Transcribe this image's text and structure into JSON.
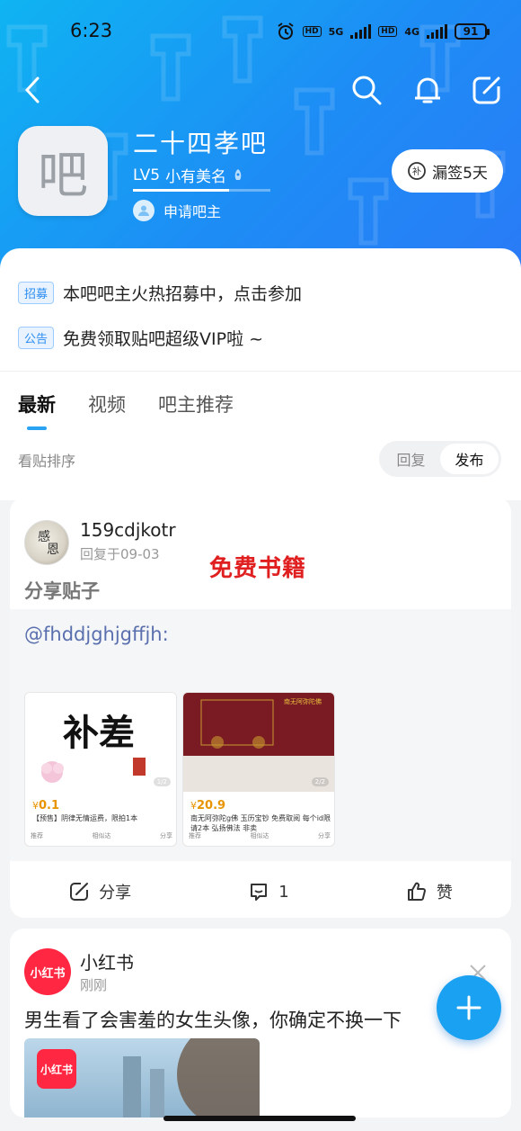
{
  "status_bar": {
    "time": "6:23",
    "net1": "5G",
    "net2": "4G",
    "battery": "91"
  },
  "forum": {
    "avatar_char": "吧",
    "name": "二十四孝吧",
    "level": "LV5",
    "level_title": "小有美名",
    "level_progress": 0.7,
    "apply_owner": "申请吧主",
    "sign_label": "漏签5天"
  },
  "notices": [
    {
      "tag": "招募",
      "text": "本吧吧主火热招募中，点击参加"
    },
    {
      "tag": "公告",
      "text": "免费领取贴吧超级VIP啦 ~"
    }
  ],
  "tabs": [
    "最新",
    "视频",
    "吧主推荐"
  ],
  "sort": {
    "label": "看贴排序",
    "options": [
      "回复",
      "发布"
    ],
    "selected": "发布"
  },
  "post": {
    "username": "159cdjkotr",
    "time": "回复于09-03",
    "overlay_text": "免费书籍",
    "title": "分享贴子",
    "mention": "@fhddjghjgffjh:",
    "goods": [
      {
        "image_text": "补差",
        "price": "0.1",
        "desc": "【预售】阴律无情运费，限拍1本",
        "pager": "1/2",
        "foot": [
          "推荐",
          "相似达",
          "分享"
        ]
      },
      {
        "image_text": "南无阿弥陀佛",
        "price": "20.9",
        "desc": "南无阿弥陀g佛 玉历宝钞 免费取阅 每个id限请2本 弘扬佛法 非卖",
        "pager": "2/2",
        "foot": [
          "推荐",
          "相似达",
          "分享"
        ]
      }
    ],
    "actions": {
      "share": "分享",
      "comments": "1",
      "like": "赞"
    }
  },
  "ad": {
    "logo": "小红书",
    "name": "小红书",
    "time": "刚刚",
    "title": "男生看了会害羞的女生头像，你确定不换一下"
  },
  "colors": {
    "header_start": "#0fb4f2",
    "header_end": "#2a7bf6",
    "accent": "#1aa1f2",
    "red": "#e02020"
  }
}
